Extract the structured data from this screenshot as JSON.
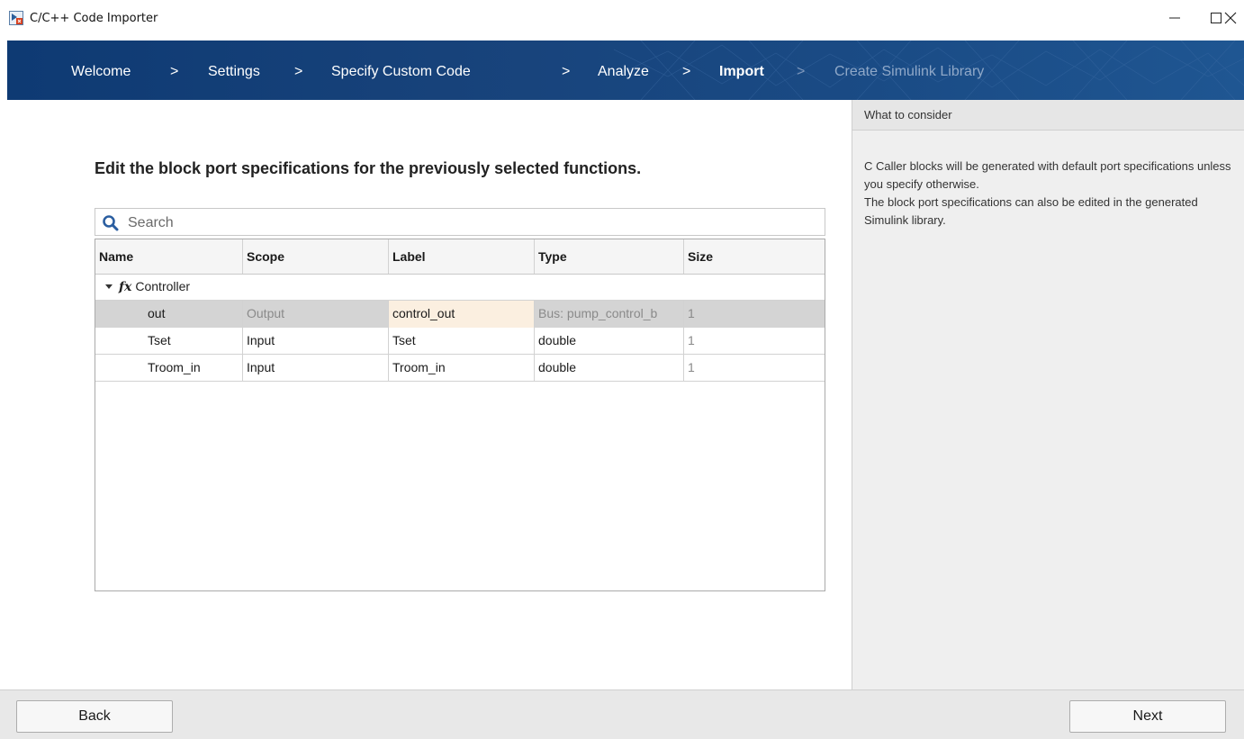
{
  "window": {
    "title": "C/C++ Code Importer"
  },
  "breadcrumb": {
    "steps": [
      {
        "label": "Welcome",
        "state": "done"
      },
      {
        "label": "Settings",
        "state": "done"
      },
      {
        "label": "Specify Custom Code",
        "state": "done"
      },
      {
        "label": "Analyze",
        "state": "done"
      },
      {
        "label": "Import",
        "state": "current"
      },
      {
        "label": "Create Simulink Library",
        "state": "disabled"
      }
    ],
    "separator": ">"
  },
  "main": {
    "heading": "Edit the block port specifications for the previously selected functions.",
    "search": {
      "placeholder": "Search",
      "value": ""
    },
    "table": {
      "columns": [
        "Name",
        "Scope",
        "Label",
        "Type",
        "Size"
      ],
      "group": {
        "icon": "fx",
        "label": "Controller",
        "expanded": true
      },
      "rows": [
        {
          "name": "out",
          "scope": "Output",
          "label": "control_out",
          "type": "Bus: pump_control_b",
          "size": "1",
          "selected": true,
          "editing_label": true
        },
        {
          "name": "Tset",
          "scope": "Input",
          "label": "Tset",
          "type": "double",
          "size": "1",
          "selected": false
        },
        {
          "name": "Troom_in",
          "scope": "Input",
          "label": "Troom_in",
          "type": "double",
          "size": "1",
          "selected": false
        }
      ]
    }
  },
  "side_panel": {
    "title": "What to consider",
    "paragraphs": [
      "C Caller blocks will be generated with default port specifications unless you specify otherwise.",
      "The block port specifications can also be edited in the generated Simulink library."
    ]
  },
  "footer": {
    "back_label": "Back",
    "next_label": "Next"
  },
  "colors": {
    "header_bg": "#17427a",
    "selected_row": "#d4d4d4",
    "editing_cell": "#fbefe0",
    "side_panel_bg": "#efefef"
  }
}
